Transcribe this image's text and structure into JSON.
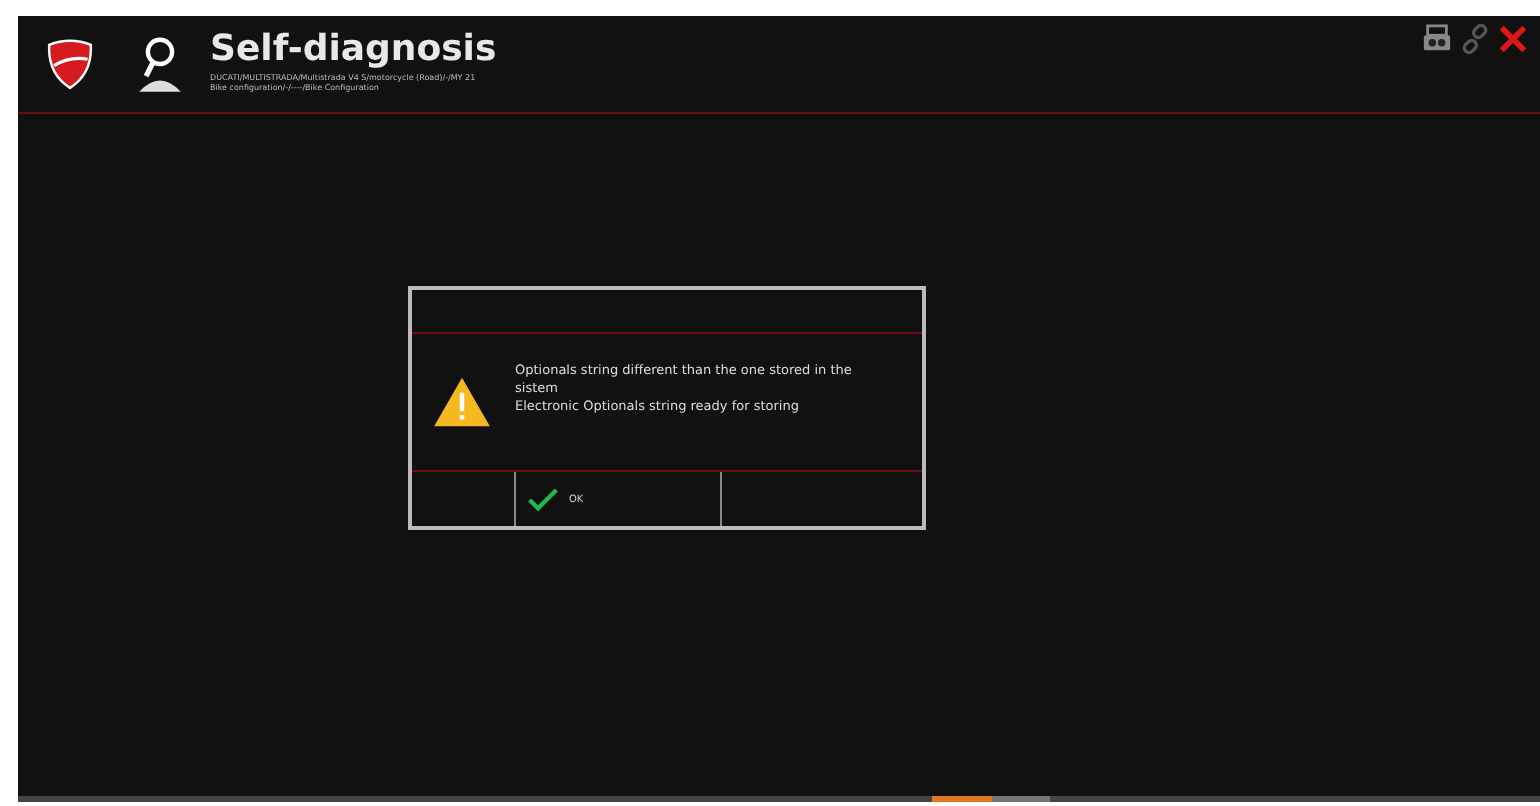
{
  "header": {
    "title": "Self-diagnosis",
    "path_lines": [
      "DUCATI/MULTISTRADA/Multistrada V4 S/motorcycle (Road)/-/MY 21",
      "Bike configuration/-/----/Bike Configuration"
    ]
  },
  "dialog": {
    "message": "Optionals string different than the one stored in the sistem\nElectronic Optionals string ready for storing",
    "buttons": [
      {
        "kind": "empty"
      },
      {
        "kind": "ok",
        "label": "OK"
      },
      {
        "kind": "empty"
      }
    ]
  }
}
